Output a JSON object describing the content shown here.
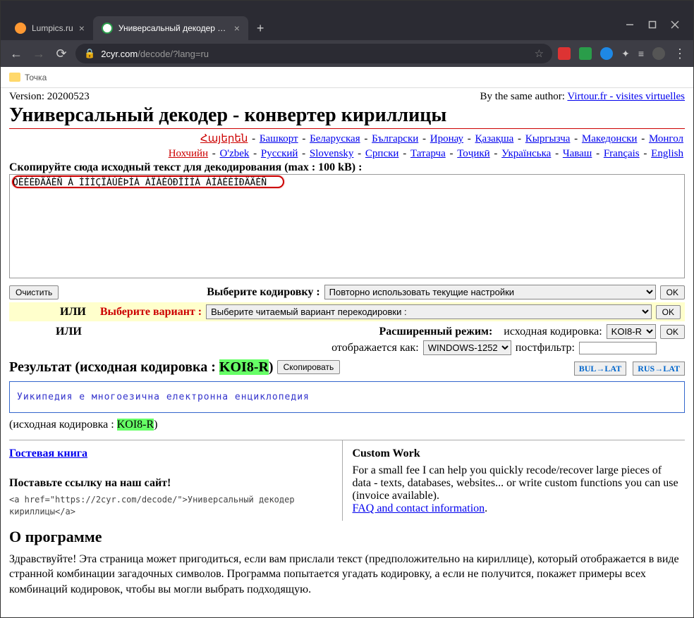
{
  "window": {
    "tab1_title": "Lumpics.ru",
    "tab2_title": "Универсальный декодер - конв",
    "url_domain": "2cyr.com",
    "url_path": "/decode/?lang=ru",
    "bookmark": "Точка"
  },
  "page": {
    "version": "Version: 20200523",
    "same_author": "By the same author: ",
    "virtour_link": "Virtour.fr - visites virtuelles",
    "title": "Универсальный декодер - конвертер кириллицы",
    "langs_line1": [
      "Հայերեն",
      "Башкорт",
      "Беларуская",
      "Български",
      "Иронау",
      "Қазақша",
      "Кыргызча",
      "Македонски",
      "Монгол"
    ],
    "langs_line2": [
      "Нохчийн",
      "O'zbek",
      "Русский",
      "Slovensky",
      "Српски",
      "Татарча",
      "Тоҷикӣ",
      "Українська",
      "Чаваш",
      "Français",
      "English"
    ],
    "copy_label": "Скопируйте сюда исходный текст для декодирования (max : 100 kB) :",
    "source_text": "ÓÈÈÈÐÄÄÈÑ À ÌÍÌÇÏÀÚÈÞÍÀ ÀÏÀÈÒÐÎÍÍÀ ÀÍÀÈÈÌÐÄÄÈÑ",
    "clear_btn": "Очистить",
    "choose_enc_label": "Выберите кодировку :",
    "enc_select": "Повторно использовать текущие настройки",
    "ok": "OK",
    "or": "ИЛИ",
    "choose_variant": "Выберите вариант :",
    "variant_select": "Выберите читаемый вариант перекодировки :",
    "ext_mode": "Расширенный режим:",
    "src_enc_label": "исходная кодировка:",
    "src_enc": "KOI8-R",
    "shown_as": "отображается как:",
    "shown_enc": "WINDOWS-1252",
    "postfilter_label": "постфильтр:",
    "result_label_a": "Результат (исходная кодировка : ",
    "koi": "KOI8-R",
    "result_label_b": ")",
    "copy_btn": "Скопировать",
    "bul_lat": "BUL→LAT",
    "rus_lat": "RUS→LAT",
    "result_text": "Уикипедия е многоезична електронна енциклопедия",
    "src_enc_note_a": "(исходная кодировка : ",
    "src_enc_note_b": ")",
    "guestbook": "Гостевая книга",
    "put_link": "Поставьте ссылку на наш сайт!",
    "snippet": "<a href=\"https://2cyr.com/decode/\">Универсальный декодер кириллицы</a>",
    "custom_title": "Custom Work",
    "custom_text": "For a small fee I can help you quickly recode/recover large pieces of data - texts, databases, websites... or write custom functions you can use (invoice available).",
    "faq_link": "FAQ and contact information",
    "about_title": "О программе",
    "about_para": "Здравствуйте! Эта страница может пригодиться, если вам прислали текст (предположительно на кириллице), который отображается в виде странной комбинации загадочных символов. Программа попытается угадать кодировку, а если не получится, покажет примеры всех комбинаций кодировок, чтобы вы могли выбрать подходящую."
  }
}
